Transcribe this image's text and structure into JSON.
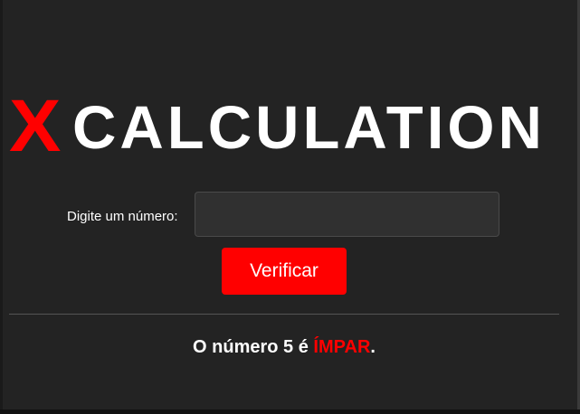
{
  "logo": {
    "x_letter": "X",
    "text": "CALCULATION"
  },
  "form": {
    "input_label": "Digite um número:",
    "input_value": "",
    "input_placeholder": "",
    "button_label": "Verificar"
  },
  "result": {
    "prefix": "O número 5 é ",
    "value": "ÍMPAR",
    "suffix": "."
  },
  "colors": {
    "accent": "#ff0000",
    "background": "#232323",
    "text": "#ffffff"
  }
}
